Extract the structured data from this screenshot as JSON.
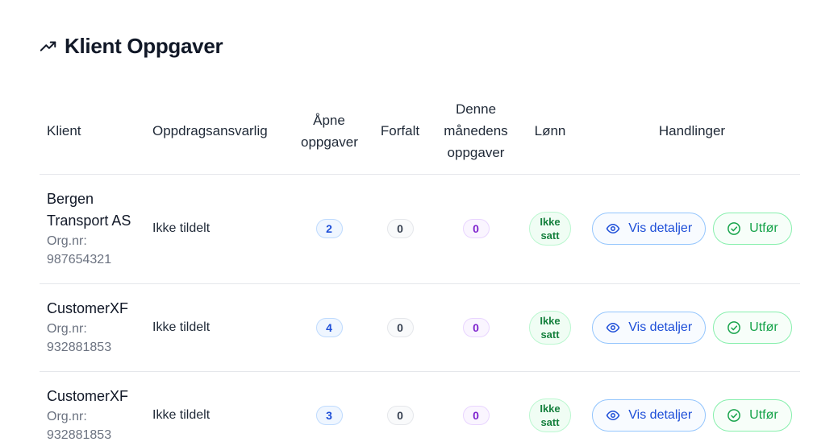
{
  "header": {
    "title": "Klient Oppgaver",
    "icon": "trending-up-icon"
  },
  "table": {
    "columns": {
      "client": "Klient",
      "assignee": "Oppdragsansvarlig",
      "open_tasks": "Åpne oppgaver",
      "overdue": "Forfalt",
      "this_month": "Denne månedens oppgaver",
      "salary": "Lønn",
      "actions": "Handlinger"
    },
    "rows": [
      {
        "client_name": "Bergen Transport AS",
        "org_label": "Org.nr:",
        "org_number": "987654321",
        "assignee": "Ikke tildelt",
        "open_tasks": "2",
        "overdue": "0",
        "this_month": "0",
        "salary_line1": "Ikke",
        "salary_line2": "satt",
        "view_label": "Vis detaljer",
        "do_label": "Utfør"
      },
      {
        "client_name": "CustomerXF",
        "org_label": "Org.nr:",
        "org_number": "932881853",
        "assignee": "Ikke tildelt",
        "open_tasks": "4",
        "overdue": "0",
        "this_month": "0",
        "salary_line1": "Ikke",
        "salary_line2": "satt",
        "view_label": "Vis detaljer",
        "do_label": "Utfør"
      },
      {
        "client_name": "CustomerXF",
        "org_label": "Org.nr:",
        "org_number": "932881853",
        "assignee": "Ikke tildelt",
        "open_tasks": "3",
        "overdue": "0",
        "this_month": "0",
        "salary_line1": "Ikke",
        "salary_line2": "satt",
        "view_label": "Vis detaljer",
        "do_label": "Utfør"
      }
    ]
  },
  "colors": {
    "open_badge": "#1d4ed8",
    "month_badge": "#7e22ce",
    "salary_badge": "#15803d",
    "view_button": "#1d4ed8",
    "do_button": "#16a34a"
  }
}
